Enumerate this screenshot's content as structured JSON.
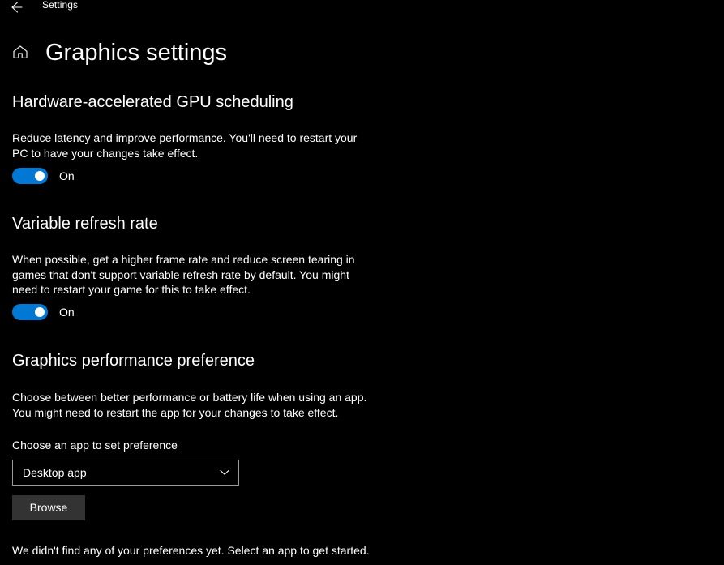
{
  "window": {
    "back_icon": "back-arrow-icon",
    "breadcrumb": "Settings",
    "home_icon": "home-icon",
    "title": "Graphics settings"
  },
  "colors": {
    "background": "#000000",
    "accent": "#0078d4",
    "text": "#ffffff",
    "button_fill": "#333333",
    "input_border": "#9a9a9a"
  },
  "sections": [
    {
      "heading": "Hardware-accelerated GPU scheduling",
      "description": "Reduce latency and improve performance. You'll need to restart your PC to have your changes take effect.",
      "toggle_state": "On"
    },
    {
      "heading": "Variable refresh rate",
      "description": "When possible, get a higher frame rate and reduce screen tearing in games that don't support variable refresh rate by default. You might need to restart your game for this to take effect.",
      "toggle_state": "On"
    },
    {
      "heading": "Graphics performance preference",
      "description": "Choose between better performance or battery life when using an app. You might need to restart the app for your changes to take effect."
    }
  ],
  "preference": {
    "field_label": "Choose an app to set preference",
    "dropdown_value": "Desktop app",
    "dropdown_icon": "chevron-down-icon",
    "browse_label": "Browse",
    "empty_state": "We didn't find any of your preferences yet. Select an app to get started."
  }
}
